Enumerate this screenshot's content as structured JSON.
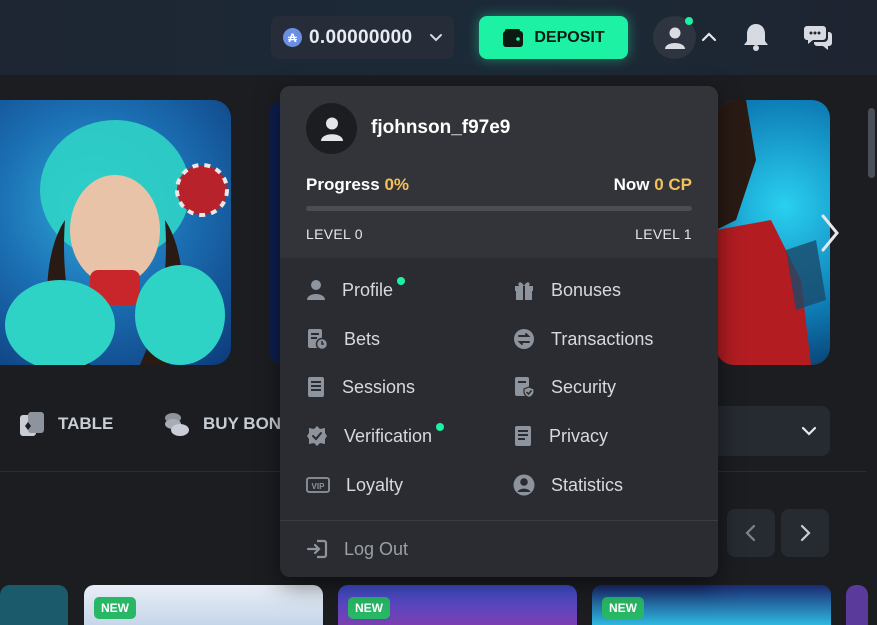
{
  "header": {
    "balance": {
      "coin_symbol": "₳",
      "value": "0.00000000"
    },
    "deposit_label": "DEPOSIT",
    "accent_color": "#1df2a4"
  },
  "categories": [
    {
      "label": "TABLE",
      "icon": "cards-icon"
    },
    {
      "label": "BUY BON",
      "icon": "coins-icon"
    }
  ],
  "thumbnails": [
    {
      "badge": "NEW"
    },
    {
      "badge": "NEW"
    },
    {
      "badge": "NEW"
    }
  ],
  "user_menu": {
    "username": "fjohnson_f97e9",
    "progress_label": "Progress",
    "progress_value": "0%",
    "progress_fraction": 0,
    "now_label": "Now",
    "now_value": "0 CP",
    "level_current": "LEVEL 0",
    "level_next": "LEVEL 1",
    "items_left": [
      {
        "label": "Profile",
        "icon": "user-icon",
        "dot": true
      },
      {
        "label": "Bets",
        "icon": "bets-icon",
        "dot": false
      },
      {
        "label": "Sessions",
        "icon": "sessions-icon",
        "dot": false
      },
      {
        "label": "Verification",
        "icon": "verified-shield-icon",
        "dot": true
      },
      {
        "label": "Loyalty",
        "icon": "vip-icon",
        "dot": false
      }
    ],
    "items_right": [
      {
        "label": "Bonuses",
        "icon": "gift-icon"
      },
      {
        "label": "Transactions",
        "icon": "transfer-icon"
      },
      {
        "label": "Security",
        "icon": "security-icon"
      },
      {
        "label": "Privacy",
        "icon": "document-icon"
      },
      {
        "label": "Statistics",
        "icon": "user-circle-icon"
      }
    ],
    "logout_label": "Log Out"
  }
}
